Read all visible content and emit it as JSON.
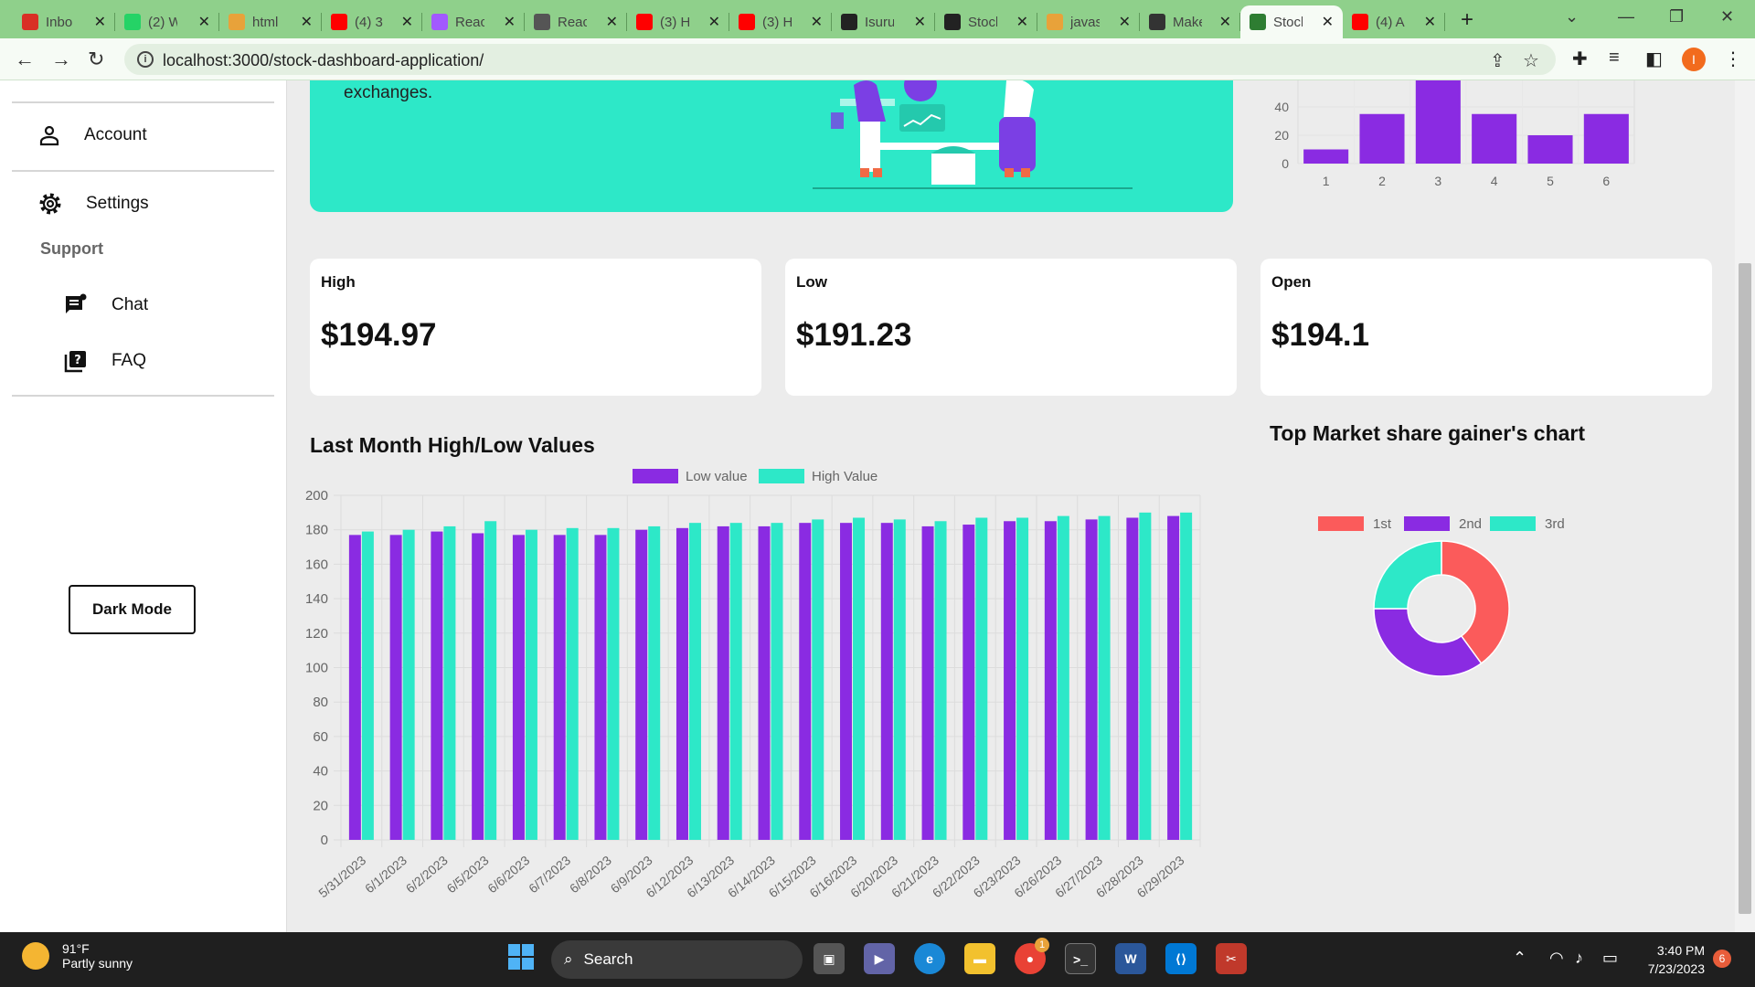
{
  "browser": {
    "tabs": [
      {
        "label": "Inbo",
        "icon": "gmail-icon",
        "color": "#d93025"
      },
      {
        "label": "(2) W",
        "icon": "whatsapp-icon",
        "color": "#25d366"
      },
      {
        "label": "html",
        "icon": "pen-icon",
        "color": "#e8a23a"
      },
      {
        "label": "(4) 3",
        "icon": "youtube-icon",
        "color": "#ff0000"
      },
      {
        "label": "Reac",
        "icon": "figma-icon",
        "color": "#a259ff"
      },
      {
        "label": "Reac",
        "icon": "openai-icon",
        "color": "#555555"
      },
      {
        "label": "(3) H",
        "icon": "youtube-icon",
        "color": "#ff0000"
      },
      {
        "label": "(3) H",
        "icon": "youtube-icon",
        "color": "#ff0000"
      },
      {
        "label": "Isuru",
        "icon": "github-icon",
        "color": "#222222"
      },
      {
        "label": "Stocl",
        "icon": "globe-icon",
        "color": "#222222"
      },
      {
        "label": "javas",
        "icon": "pen-icon",
        "color": "#e8a23a"
      },
      {
        "label": "Make",
        "icon": "document-icon",
        "color": "#333333"
      },
      {
        "label": "Stocl",
        "icon": "chart-icon",
        "color": "#2e7d32"
      },
      {
        "label": "(4) A",
        "icon": "youtube-icon",
        "color": "#ff0000"
      }
    ],
    "url": "localhost:3000/stock-dashboard-application/",
    "profile_initial": "I"
  },
  "sidebar": {
    "account": "Account",
    "settings": "Settings",
    "support": "Support",
    "chat": "Chat",
    "faq": "FAQ",
    "dark_mode": "Dark Mode"
  },
  "hero": {
    "text": "exchanges."
  },
  "stats": {
    "high": {
      "label": "High",
      "value": "$194.97"
    },
    "low": {
      "label": "Low",
      "value": "$191.23"
    },
    "open": {
      "label": "Open",
      "value": "$194.1"
    }
  },
  "charts": {
    "hl_title": "Last Month High/Low Values",
    "pie_title": "Top Market share gainer's chart"
  },
  "chart_data": [
    {
      "type": "bar",
      "categories": [
        "1",
        "2",
        "3",
        "4",
        "5",
        "6"
      ],
      "values": [
        10,
        35,
        60,
        35,
        20,
        35
      ],
      "ylim": [
        0,
        60
      ],
      "yticks": [
        0,
        20,
        40
      ],
      "colors": [
        "#8a2be2"
      ]
    },
    {
      "type": "bar",
      "title": "Last Month High/Low Values",
      "categories": [
        "5/31/2023",
        "6/1/2023",
        "6/2/2023",
        "6/5/2023",
        "6/6/2023",
        "6/7/2023",
        "6/8/2023",
        "6/9/2023",
        "6/12/2023",
        "6/13/2023",
        "6/14/2023",
        "6/15/2023",
        "6/16/2023",
        "6/20/2023",
        "6/21/2023",
        "6/22/2023",
        "6/23/2023",
        "6/26/2023",
        "6/27/2023",
        "6/28/2023",
        "6/29/2023"
      ],
      "series": [
        {
          "name": "Low value",
          "color": "#8a2be2",
          "values": [
            177,
            177,
            179,
            178,
            177,
            177,
            177,
            180,
            181,
            182,
            182,
            184,
            184,
            184,
            182,
            183,
            185,
            185,
            186,
            187,
            188
          ]
        },
        {
          "name": "High Value",
          "color": "#2de8c8",
          "values": [
            179,
            180,
            182,
            185,
            180,
            181,
            181,
            182,
            184,
            184,
            184,
            186,
            187,
            186,
            185,
            187,
            187,
            188,
            188,
            190,
            190
          ]
        }
      ],
      "ylim": [
        0,
        200
      ],
      "yticks": [
        0,
        20,
        40,
        60,
        80,
        100,
        120,
        140,
        160,
        180,
        200
      ],
      "legend": "top",
      "grid": true
    },
    {
      "type": "pie",
      "title": "Top Market share gainer's chart",
      "labels": [
        "1st",
        "2nd",
        "3rd"
      ],
      "values": [
        40,
        35,
        25
      ],
      "colors": [
        "#fb5b5b",
        "#8a2be2",
        "#2de8c8"
      ],
      "legend": "top"
    }
  ],
  "taskbar": {
    "temp": "91°F",
    "condition": "Partly sunny",
    "search": "Search",
    "time": "3:40 PM",
    "date": "7/23/2023",
    "notifications": "6",
    "chrome_badge": "1"
  }
}
